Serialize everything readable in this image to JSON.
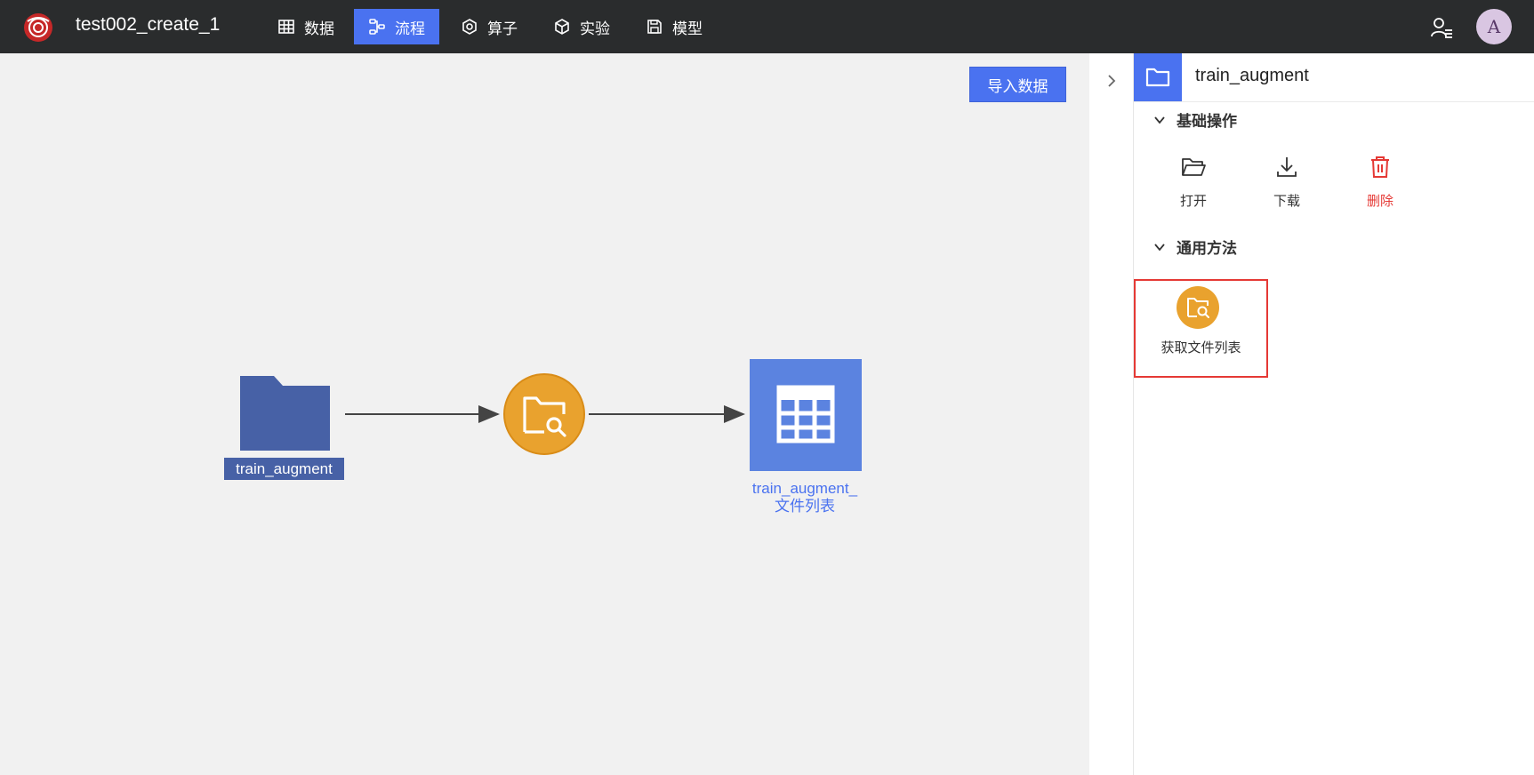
{
  "app": {
    "project_title": "test002_create_1",
    "avatar_initial": "A"
  },
  "nav": {
    "tabs": [
      {
        "label": "数据",
        "icon": "table-icon",
        "active": false
      },
      {
        "label": "流程",
        "icon": "flow-icon",
        "active": true
      },
      {
        "label": "算子",
        "icon": "hexagon-icon",
        "active": false
      },
      {
        "label": "实验",
        "icon": "cube-icon",
        "active": false
      },
      {
        "label": "模型",
        "icon": "save-icon",
        "active": false
      }
    ]
  },
  "canvas": {
    "import_button_label": "导入数据",
    "source_node_label": "train_augment",
    "output_node_label_line1": "train_augment_",
    "output_node_label_line2": "文件列表"
  },
  "panel": {
    "title": "train_augment",
    "basic_section_title": "基础操作",
    "operations": [
      {
        "label": "打开",
        "icon": "folder-open-icon"
      },
      {
        "label": "下载",
        "icon": "download-icon"
      },
      {
        "label": "删除",
        "icon": "trash-icon"
      }
    ],
    "methods_section_title": "通用方法",
    "methods": [
      {
        "label": "获取文件列表",
        "icon": "folder-search-icon"
      }
    ]
  },
  "colors": {
    "accent": "#4a72f0",
    "topbar": "#2a2c2d",
    "folder_node": "#4761a6",
    "operator_node": "#e9a22e",
    "table_node": "#5b83e0",
    "danger": "#e53935"
  }
}
